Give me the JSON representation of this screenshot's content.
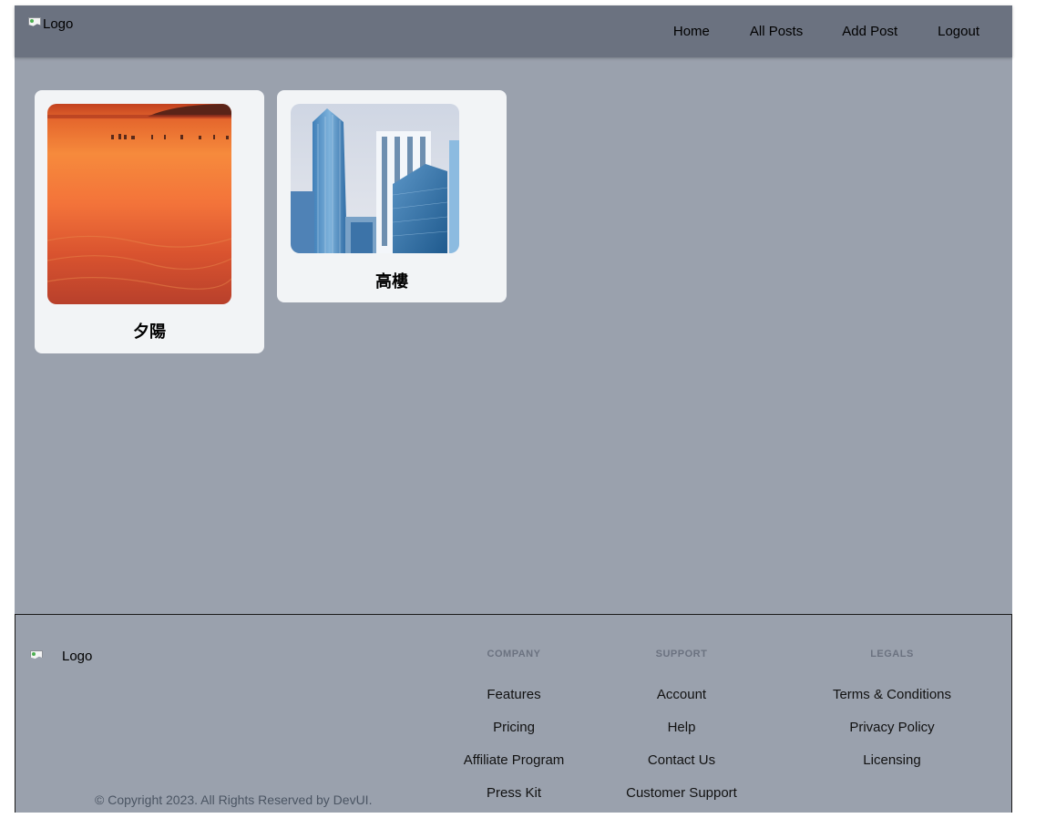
{
  "header": {
    "logo_alt": "Logo",
    "nav": [
      "Home",
      "All Posts",
      "Add Post",
      "Logout"
    ]
  },
  "posts": [
    {
      "title": "夕陽",
      "image": "sunset-beach-photo"
    },
    {
      "title": "高樓",
      "image": "skyscrapers-photo"
    }
  ],
  "footer": {
    "logo_alt": "Logo",
    "copyright": "© Copyright 2023. All Rights Reserved by DevUI.",
    "columns": [
      {
        "heading": "COMPANY",
        "links": [
          "Features",
          "Pricing",
          "Affiliate Program",
          "Press Kit"
        ]
      },
      {
        "heading": "SUPPORT",
        "links": [
          "Account",
          "Help",
          "Contact Us",
          "Customer Support"
        ]
      },
      {
        "heading": "LEGALS",
        "links": [
          "Terms & Conditions",
          "Privacy Policy",
          "Licensing"
        ]
      }
    ]
  },
  "colors": {
    "navbar": "#6b7280",
    "page_background": "#9aa1ad",
    "card_background": "#f2f4f6",
    "footer_heading": "#6b7280"
  }
}
